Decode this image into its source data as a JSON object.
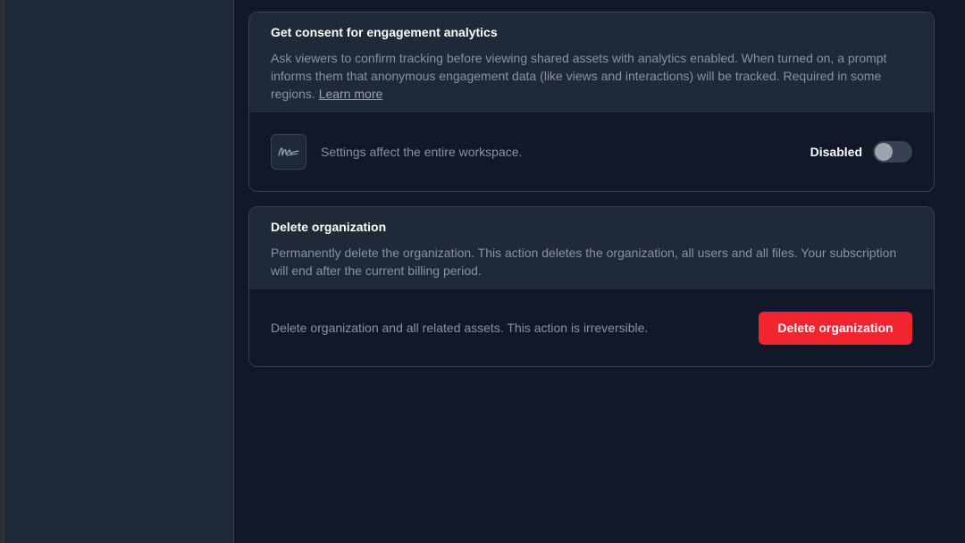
{
  "consent_card": {
    "title": "Get consent for engagement analytics",
    "description": "Ask viewers to confirm tracking before viewing shared assets with analytics enabled. When turned on, a prompt informs them that anonymous engagement data (like views and interactions) will be tracked. Required in some regions. ",
    "learn_more_label": "Learn more",
    "icon": "signature-icon",
    "footer_text": "Settings affect the entire workspace.",
    "toggle_label": "Disabled",
    "toggle_enabled": false
  },
  "delete_card": {
    "title": "Delete organization",
    "description": "Permanently delete the organization. This action deletes the organization, all users and all files. Your subscription will end after the current billing period.",
    "footer_text": "Delete organization and all related assets. This action is irreversible.",
    "button_label": "Delete organization"
  },
  "colors": {
    "background": "#111827",
    "card_header": "#1f2937",
    "border": "#374151",
    "danger": "#f0252f",
    "muted_text": "#8b929e"
  }
}
